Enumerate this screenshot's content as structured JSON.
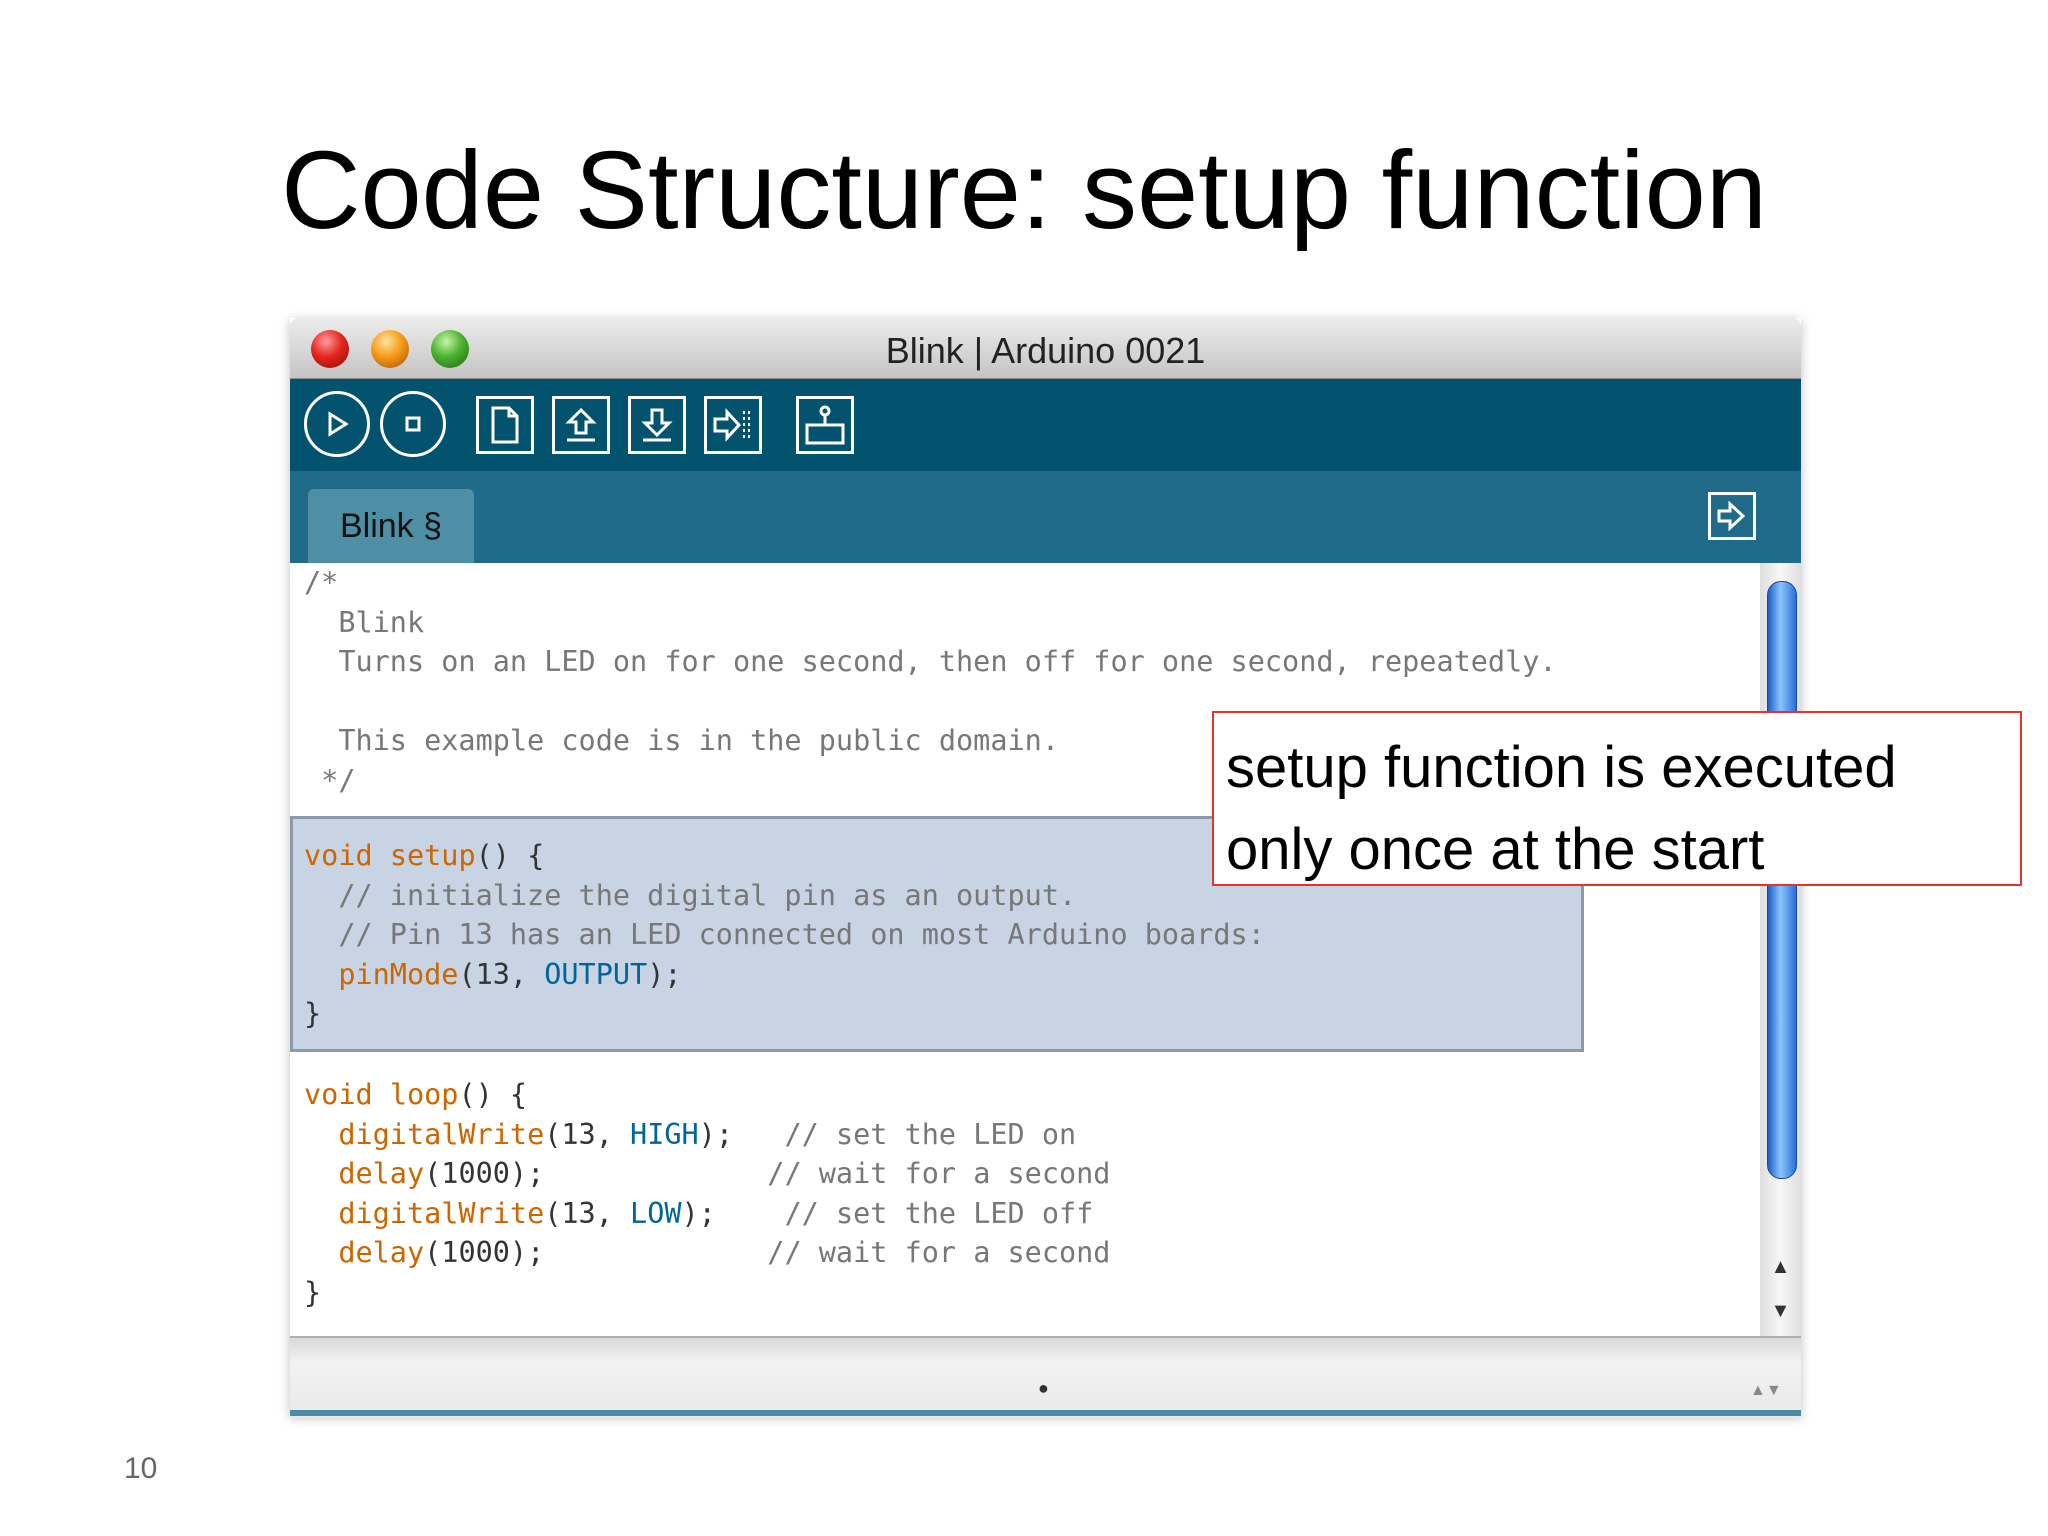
{
  "slide": {
    "title": "Code Structure: setup function",
    "page_number": "10"
  },
  "window": {
    "title": "Blink | Arduino 0021"
  },
  "toolbar": {
    "buttons": [
      {
        "name": "verify",
        "icon": "play-icon"
      },
      {
        "name": "stop",
        "icon": "stop-icon"
      },
      {
        "name": "new",
        "icon": "new-file-icon"
      },
      {
        "name": "open",
        "icon": "open-icon"
      },
      {
        "name": "save",
        "icon": "save-icon"
      },
      {
        "name": "upload",
        "icon": "upload-icon"
      },
      {
        "name": "serial-monitor",
        "icon": "serial-monitor-icon"
      }
    ]
  },
  "tabs": [
    {
      "label": "Blink §"
    }
  ],
  "code": {
    "header": [
      "/*",
      "  Blink",
      "  Turns on an LED on for one second, then off for one second, repeatedly.",
      "",
      "  This example code is in the public domain.",
      " */"
    ],
    "setup": {
      "line1_kw": "void",
      "line1_fn": "setup",
      "line1_rest": "() {",
      "comment1": "  // initialize the digital pin as an output.",
      "comment2": "  // Pin 13 has an LED connected on most Arduino boards:",
      "pinmode_fn": "pinMode",
      "pinmode_args": "(13, ",
      "pinmode_const": "OUTPUT",
      "pinmode_end": ");",
      "close": "}"
    },
    "loop": {
      "line1_kw": "void",
      "line1_fn": "loop",
      "line1_rest": "() {",
      "lines": [
        {
          "fn": "digitalWrite",
          "args": "(13, ",
          "const": "HIGH",
          "end": ");",
          "pad": "   ",
          "comment": "// set the LED on"
        },
        {
          "fn": "delay",
          "args": "(1000);",
          "const": "",
          "end": "",
          "pad": "             ",
          "comment": "// wait for a second"
        },
        {
          "fn": "digitalWrite",
          "args": "(13, ",
          "const": "LOW",
          "end": ");",
          "pad": "    ",
          "comment": "// set the LED off"
        },
        {
          "fn": "delay",
          "args": "(1000);",
          "const": "",
          "end": "",
          "pad": "             ",
          "comment": "// wait for a second"
        }
      ],
      "close": "}"
    }
  },
  "callout": {
    "line1": "setup function is executed",
    "line2": "only once at the start"
  },
  "colors": {
    "toolbar": "#03536f",
    "tabbar": "#216b8a",
    "highlight": "#c8d3e3",
    "keyword": "#cc6600",
    "constant": "#006699",
    "comment": "#777777",
    "callout_border": "#e0362c"
  }
}
